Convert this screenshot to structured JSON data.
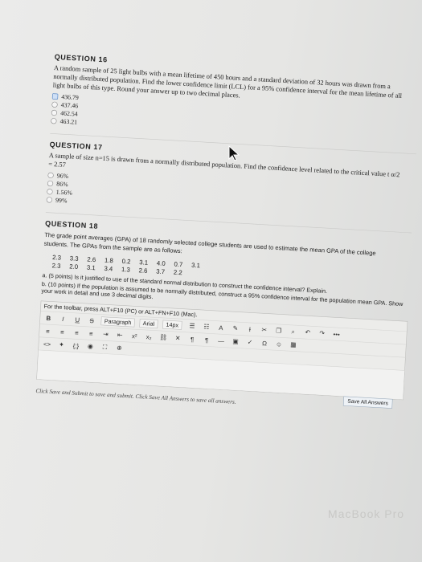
{
  "q16": {
    "title": "QUESTION 16",
    "text": "A random sample of 25 light bulbs with a mean lifetime of 450 hours and a standard deviation of 32 hours was drawn from a normally distributed population. Find the lower confidence limit (LCL) for a 95% confidence interval for the mean lifetime of all light bulbs of this type. Round your answer up to two decimal places.",
    "options": [
      "436.79",
      "437.46",
      "462.54",
      "463.21"
    ],
    "selected_index": 0
  },
  "q17": {
    "title": "QUESTION 17",
    "text": "A sample of size n=15 is drawn from a normally distributed population. Find the confidence level related to the critical value t α/2 = 2.57",
    "options": [
      "96%",
      "86%",
      "1.56%",
      "99%"
    ]
  },
  "q18": {
    "title": "QUESTION 18",
    "text": "The grade point averages (GPA) of 18 randomly selected college students are used to estimate the mean GPA of the college students. The GPAs from the sample are as follows:",
    "gpa_rows": [
      [
        "2.3",
        "3.3",
        "2.6",
        "1.8",
        "0.2",
        "3.1",
        "4.0",
        "0.7",
        "3.1"
      ],
      [
        "2.3",
        "2.0",
        "3.1",
        "3.4",
        "1.3",
        "2.6",
        "3.7",
        "2.2",
        ""
      ]
    ],
    "part_a": "a. (5 points) Is it justified to use of the standard normal distribution to construct the confidence interval? Explain.",
    "part_b": "b. (10 points) If the population is assumed to be normally distributed, construct a 95% confidence interval for the population mean GPA. Show your work in detail and use 3 decimal digits."
  },
  "editor": {
    "hint": "For the toolbar, press ALT+F10 (PC) or ALT+FN+F10 (Mac).",
    "paragraph": "Paragraph",
    "font": "Arial",
    "size": "14px",
    "row1": [
      "B",
      "I",
      "U",
      "S"
    ],
    "row2": [
      "x²",
      "x₂"
    ],
    "more": "•••"
  },
  "footer": {
    "note": "Click Save and Submit to save and submit. Click Save All Answers to save all answers.",
    "save_all": "Save All Answers"
  },
  "watermark": "MacBook Pro"
}
